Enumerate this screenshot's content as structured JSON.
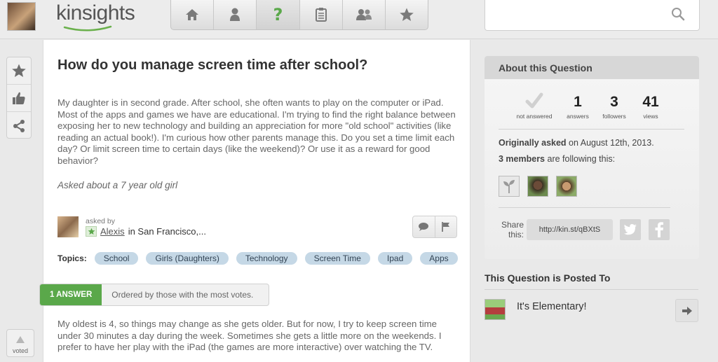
{
  "header": {
    "logo_text": "kinsights",
    "search": {
      "placeholder": ""
    },
    "nav": [
      {
        "icon": "home-icon"
      },
      {
        "icon": "person-icon"
      },
      {
        "icon": "question-icon",
        "active": true
      },
      {
        "icon": "clipboard-icon"
      },
      {
        "icon": "people-icon"
      },
      {
        "icon": "star-icon"
      }
    ]
  },
  "rail": {
    "voted_label": "voted"
  },
  "question": {
    "title": "How do you manage screen time after school?",
    "body": "My daughter is in second grade. After school, she often wants to play on the computer or iPad. Most of the apps and games we have are educational. I'm trying to find the right balance between exposing her to new technology and building an appreciation for more \"old school\" activities (like reading an actual book!). I'm curious how other parents manage this. Do you set a time limit each day? Or limit screen time to certain days (like the weekend)? Or use it as a reward for good behavior?",
    "about_child": "Asked about a 7 year old girl",
    "asked_by_label": "asked by",
    "asker_name": "Alexis",
    "asker_location": "in San Francisco,...",
    "topics_label": "Topics:",
    "topics": [
      "School",
      "Girls (Daughters)",
      "Technology",
      "Screen Time",
      "Ipad",
      "Apps"
    ]
  },
  "answers": {
    "count_label": "1 ANSWER",
    "order_label": "Ordered by those with the most votes.",
    "first_answer": "My oldest is 4, so things may change as she gets older. But for now, I try to keep screen time under 30 minutes a day during the week. Sometimes she gets a little more on the weekends. I prefer to have her play with the iPad (the games are more interactive) over watching the TV."
  },
  "about": {
    "header": "About this Question",
    "stats": {
      "answered_label": "not answered",
      "answers_num": "1",
      "answers_label": "answers",
      "followers_num": "3",
      "followers_label": "followers",
      "views_num": "41",
      "views_label": "views"
    },
    "orig_bold": "Originally asked",
    "orig_rest": " on August 12th, 2013.",
    "following_bold": "3 members",
    "following_rest": " are following this:",
    "share_label": "Share this:",
    "share_link": "http://kin.st/qBXtS"
  },
  "posted": {
    "title": "This Question is Posted To",
    "group_name": "It's Elementary!"
  },
  "colors": {
    "accent_green": "#5aa84a",
    "topic_blue": "#c5d8e6"
  }
}
